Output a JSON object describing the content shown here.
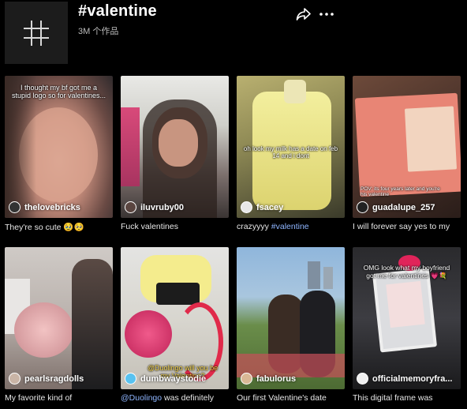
{
  "header": {
    "hashtag_title": "#valentine",
    "video_count": "3M 个作品",
    "share_icon": "share-arrow-icon",
    "more_icon": "more-dots-icon"
  },
  "videos": [
    {
      "overlay": "I thought my bf got me a stupid logo so for valentines...",
      "author": "thelovebricks",
      "caption": "They're so cute 🥹🥺",
      "caption_tag": ""
    },
    {
      "overlay": "",
      "author": "iluvruby00",
      "caption": "Fuck valentines",
      "caption_tag": ""
    },
    {
      "overlay": "oh look my milk has a date on feb 14 and i dont",
      "author": "fsacey",
      "caption": "crazyyyy ",
      "caption_tag": "#valentine"
    },
    {
      "overlay": "POV: its four years later and you're his valentine",
      "author": "guadalupe_257",
      "caption": "I will forever say yes to my",
      "caption_tag": ""
    },
    {
      "overlay": "",
      "author": "pearlsragdolls",
      "caption": "My favorite kind of",
      "caption_tag": ""
    },
    {
      "overlay": "@Duolingo will you be my Valentine?",
      "author": "dumbwaystodie",
      "caption_tag_first": "@Duolingo",
      "caption": " was definitely",
      "caption_tag": ""
    },
    {
      "overlay": "",
      "author": "fabulorus",
      "caption": "Our first Valentine's date",
      "caption_tag": ""
    },
    {
      "overlay": "OMG look what my boyfriend got me for valentines 💗💐",
      "author": "officialmemoryfra...",
      "caption": "This digital frame was",
      "caption_tag": ""
    }
  ]
}
